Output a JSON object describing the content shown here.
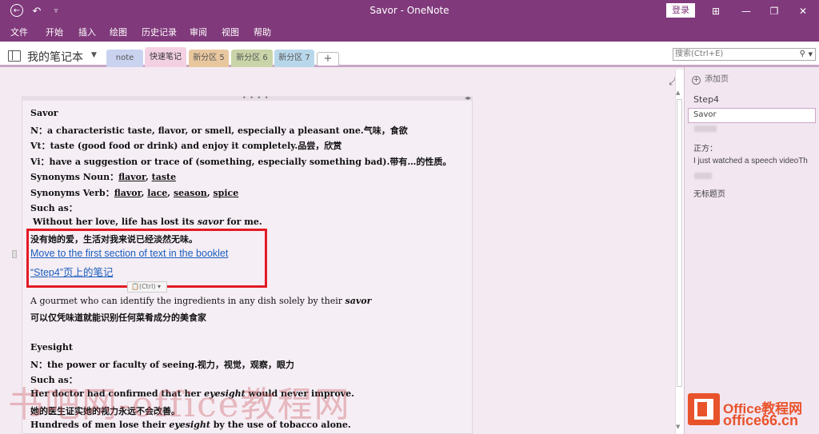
{
  "window": {
    "title": "Savor - OneNote",
    "login": "登录",
    "back_icon": "back-arrow-icon",
    "undo_icon": "undo-icon"
  },
  "menu": [
    "文件",
    "开始",
    "插入",
    "绘图",
    "历史记录",
    "审阅",
    "视图",
    "帮助"
  ],
  "notebook": {
    "name": "我的笔记本",
    "sections": [
      {
        "label": "note",
        "color": "#c9d3ef",
        "active": false
      },
      {
        "label": "快速笔记",
        "color": "#f3d1e3",
        "active": true
      },
      {
        "label": "新分区 5",
        "color": "#e8c79f",
        "active": false
      },
      {
        "label": "新分区 6",
        "color": "#c9d4a8",
        "active": false
      },
      {
        "label": "新分区 7",
        "color": "#b9d7ea",
        "active": false
      }
    ],
    "add_tab": "+"
  },
  "search": {
    "placeholder": "搜索(Ctrl+E)"
  },
  "content": {
    "title": "Savor",
    "n_line": "N：a characteristic taste, flavor, or smell, especially a pleasant one.气味，食欲",
    "vt_line": "Vt：taste (good food or drink) and enjoy it completely.品尝，欣赏",
    "vi_line": "Vi：have a suggestion or trace of (something, especially something bad).带有…的性质。",
    "syn_noun_label": "Synonyms Noun：",
    "syn_noun": [
      "flavor",
      "taste"
    ],
    "syn_verb_label": "Synonyms Verb：",
    "syn_verb": [
      "flavor",
      "lace",
      "season",
      "spice"
    ],
    "such_as": "Such as：",
    "ex1_pre": "Without her love, life has lost its ",
    "ex1_word": "savor",
    "ex1_post": " for me.",
    "ex1_cn": "没有她的爱，生活对我来说已经淡然无味。",
    "link1": "Move to the first section of text in the booklet",
    "link2": "“Step4”页上的笔记",
    "paste_label": "(Ctrl)",
    "ex2_pre": "A gourmet who can identify the ingredients in any dish solely by their ",
    "ex2_word": "savor",
    "ex2_cn": "可以仅凭味道就能识别任何菜肴成分的美食家",
    "eyesight_title": "Eyesight",
    "eyesight_n": "N：the power or faculty of seeing.视力，视觉，观察，眼力",
    "such_as2": "Such as：",
    "ex3_pre": "Her doctor had confirmed that her ",
    "ex3_word": "eyesight",
    "ex3_post": " would never improve.",
    "ex3_cn": "她的医生证实她的视力永远不会改善。",
    "ex4_pre": "Hundreds of men lose their ",
    "ex4_word": "eyesight",
    "ex4_post": " by the use of tobacco alone."
  },
  "pages": {
    "add_page": "添加页",
    "items": [
      "Step4",
      "Savor",
      "正方：",
      "I just watched a speech videoTh",
      "无标题页"
    ]
  },
  "watermark": "书吧网-office教程网",
  "logo": {
    "line1": "Office教程网",
    "line2": "office66.cn"
  }
}
